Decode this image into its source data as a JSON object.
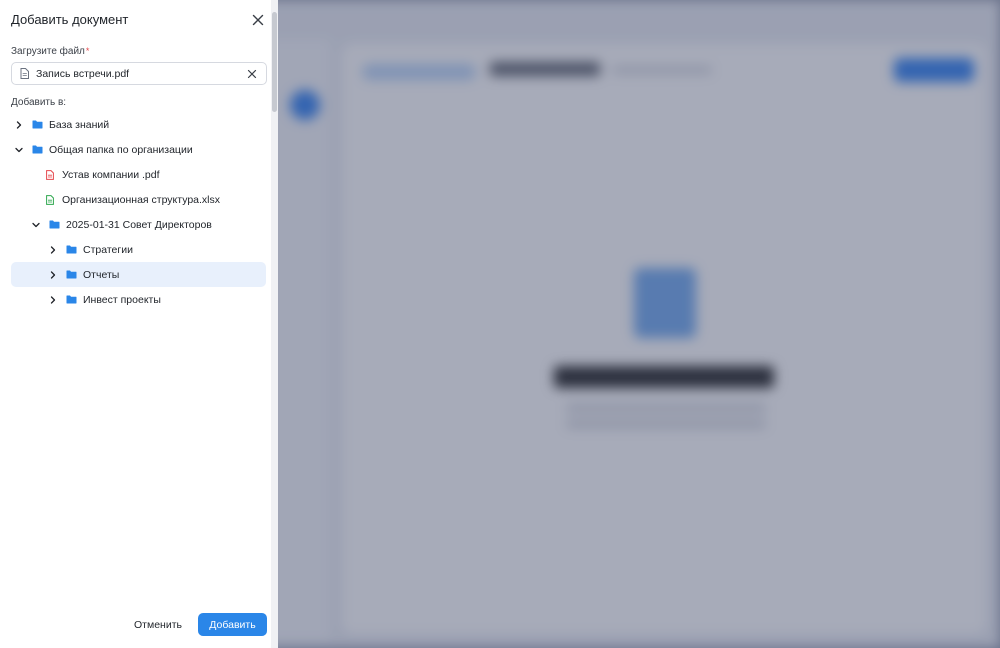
{
  "drawer": {
    "title": "Добавить документ",
    "upload_label": "Загрузите файл",
    "required_mark": "*",
    "file_name": "Запись встречи.pdf",
    "add_to_label": "Добавить в:",
    "cancel_label": "Отменить",
    "add_label": "Добавить"
  },
  "tree": [
    {
      "label": "База знаний",
      "type": "folder",
      "expanded": false,
      "depth": 0
    },
    {
      "label": "Общая папка по организации",
      "type": "folder",
      "expanded": true,
      "depth": 0
    },
    {
      "label": "Устав компании .pdf",
      "type": "pdf",
      "depth": 1
    },
    {
      "label": "Организационная структура.xlsx",
      "type": "xlsx",
      "depth": 1
    },
    {
      "label": "2025-01-31 Совет Директоров",
      "type": "folder",
      "expanded": true,
      "depth": 1
    },
    {
      "label": "Стратегии",
      "type": "folder",
      "expanded": false,
      "depth": 2
    },
    {
      "label": "Отчеты",
      "type": "folder",
      "expanded": false,
      "depth": 2,
      "selected": true
    },
    {
      "label": "Инвест проекты",
      "type": "folder",
      "expanded": false,
      "depth": 2
    }
  ],
  "colors": {
    "accent": "#2a86e8",
    "folder": "#2a86e8",
    "pdf": "#e5484d",
    "xlsx": "#2fa84f",
    "selected_bg": "#e8f0fc"
  }
}
